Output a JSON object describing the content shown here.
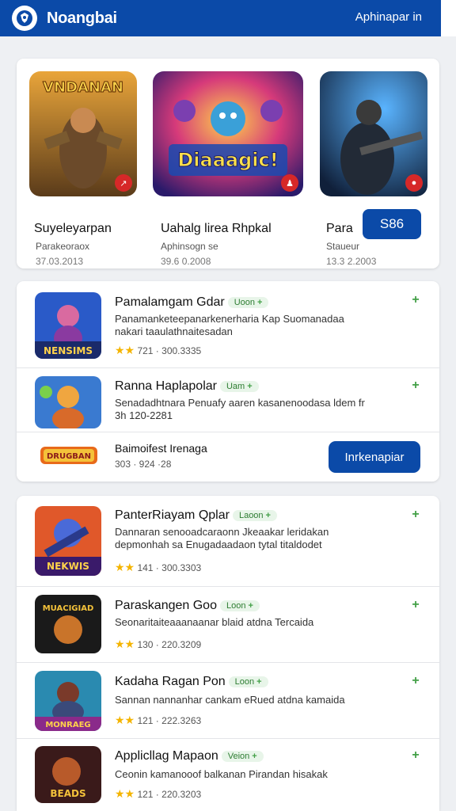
{
  "header": {
    "title": "Noangbai",
    "right_link": "Aphinapar in",
    "brand_color": "#0b4aa8"
  },
  "featured": {
    "items": [
      {
        "art_text": "VNDANAN",
        "name": "Suyeleyarpan",
        "sub": "Parakeoraox",
        "date": "37.03.2013",
        "icon": "game-art-warrior"
      },
      {
        "art_text": "Diaaagic!",
        "name": "Uahalg lirea Rhpkal",
        "sub": "Aphinsogn se",
        "date": "39.6 0.2008",
        "icon": "game-art-magic"
      },
      {
        "art_text": "",
        "name": "Para",
        "sub": "Staueur",
        "date": "13.3 2.2003",
        "icon": "game-art-soldier"
      }
    ],
    "price_button": "S86"
  },
  "list1": {
    "items": [
      {
        "art_text": "NENSIMS",
        "title": "Pamalamgam Gdar",
        "tag": "Uoon",
        "desc": "Panamanketeepanarkenerharia Kap Suomanadaa nakari taaulathnaitesadan",
        "rating": "721 · 300.3335",
        "stars": "★★"
      },
      {
        "art_text": "",
        "title": "Ranna Haplapolar",
        "tag": "Uam",
        "desc": "Senadadhtnara Penuafy aaren kasanenoodasa ldem fr 3h 120-2281",
        "rating": "",
        "stars": ""
      }
    ],
    "footer": {
      "logo_text": "DRUGBAN",
      "title": "Baimoifest Irenaga",
      "meta": "303 · 924 ·28",
      "button": "Inrkenapiar"
    }
  },
  "list2": {
    "items": [
      {
        "art_text": "NEKWIS",
        "title": "PanterRiayam Qplar",
        "tag": "Laoon",
        "desc": "Dannaran senooadcaraonn Jkeaakar leridakan depmonhah sa Enugadaadaon tytal titaldodet",
        "rating": "141 · 300.3303",
        "stars": "★★"
      },
      {
        "art_text": "MUACIGIAD",
        "title": "Paraskangen Goo",
        "tag": "Loon",
        "desc": "Seonaritaiteaaanaanar blaid atdna Tercaida",
        "rating": "130 · 220.3209",
        "stars": "★★"
      },
      {
        "art_text": "MONRAEG",
        "title": "Kadaha Ragan Pon",
        "tag": "Loon",
        "desc": "Sannan nannanhar cankam eRued atdna kamaida",
        "rating": "121 · 222.3263",
        "stars": "★★"
      },
      {
        "art_text": "BEADS",
        "title": "Applicllag Mapaon",
        "tag": "Veion",
        "desc": "Ceonin kamanooof balkanan Pirandan hisakak",
        "rating": "121 · 220.3203",
        "stars": "★★"
      }
    ]
  }
}
